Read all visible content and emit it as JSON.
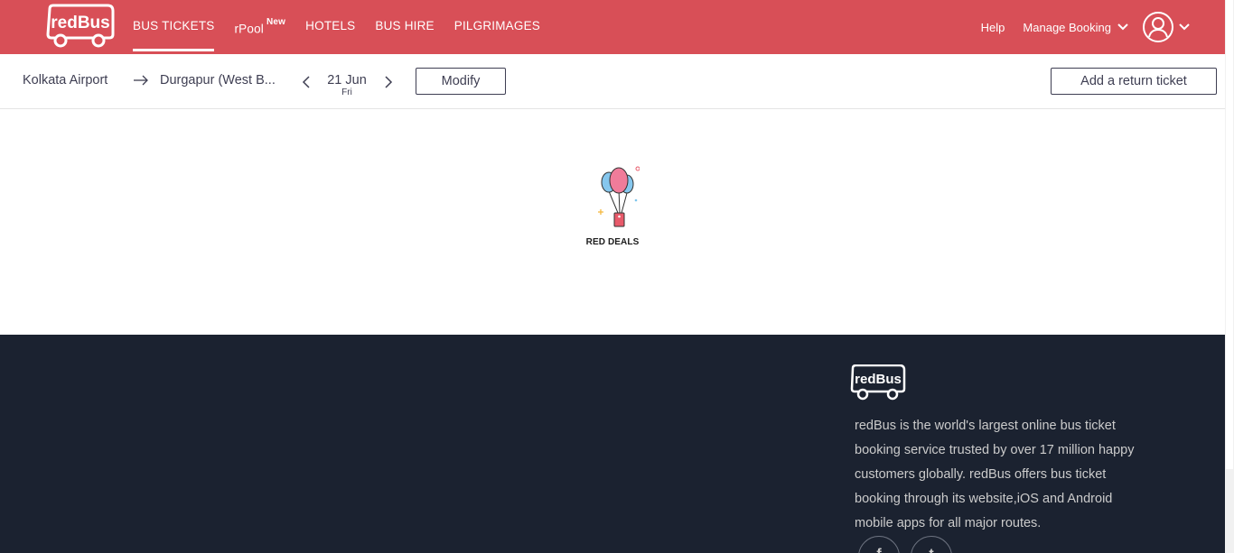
{
  "header": {
    "logo_text": "redBus",
    "nav": [
      {
        "label": "BUS TICKETS",
        "badge": ""
      },
      {
        "label": "rPool",
        "badge": "New"
      },
      {
        "label": "HOTELS",
        "badge": ""
      },
      {
        "label": "BUS HIRE",
        "badge": ""
      },
      {
        "label": "PILGRIMAGES",
        "badge": ""
      }
    ],
    "help": "Help",
    "manage_booking": "Manage Booking"
  },
  "search": {
    "source": "Kolkata Airport",
    "destination": "Durgapur (West B...",
    "date": "21 Jun",
    "weekday": "Fri",
    "modify_label": "Modify",
    "return_label": "Add a return ticket"
  },
  "deals": {
    "label": "RED DEALS"
  },
  "footer": {
    "logo_text": "redBus",
    "description": "redBus is the world's largest online bus ticket booking service trusted by over 17 million happy customers globally. redBus offers bus ticket booking through its website,iOS and Android mobile apps for all major routes."
  },
  "colors": {
    "brand": "#d84f57",
    "footer_bg": "#1b2230"
  }
}
